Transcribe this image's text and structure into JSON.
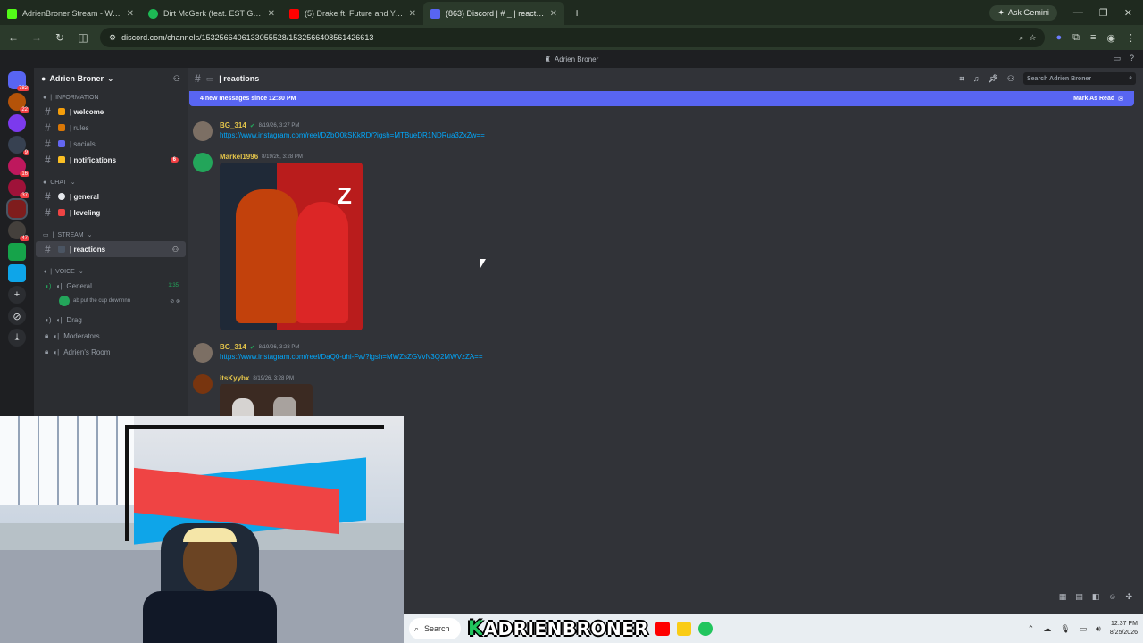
{
  "browser": {
    "tabs": [
      {
        "title": "AdrienBroner Stream - Watch L",
        "favicon_color": "#53fc18",
        "active": false
      },
      {
        "title": "Dirt McGerk (feat. EST Gee & Li",
        "favicon_color": "#1db954",
        "active": false
      },
      {
        "title": "(5) Drake ft. Future and Young",
        "favicon_color": "#ff0000",
        "active": false
      },
      {
        "title": "(863) Discord | # _ | reactions",
        "favicon_color": "#5865f2",
        "active": true
      }
    ],
    "new_tab": "+",
    "ask_gemini": "Ask Gemini",
    "url": "discord.com/channels/1532566406133055528/1532566408561426613"
  },
  "discord": {
    "title_bar": "Adrien Broner",
    "server_badges": [
      "782",
      "22",
      "",
      "9",
      "16",
      "37",
      "",
      "47",
      "",
      ""
    ],
    "guild_name": "Adrien Broner",
    "categories": {
      "information": "INFORMATION",
      "chat": "CHAT",
      "stream": "STREAM",
      "voice": "VOICE"
    },
    "channels": {
      "welcome": "| welcome",
      "rules": "| rules",
      "socials": "| socials",
      "notifications": "| notifications",
      "notifications_mentions": "6",
      "general": "| general",
      "leveling": "| leveling",
      "reactions": "| reactions"
    },
    "voice": {
      "general": "General",
      "general_timer": "1:35",
      "general_user": "ab put the cup downnnn",
      "drag": "Drag",
      "moderators": "Moderators",
      "adriens_room": "Adrien's Room"
    },
    "chat": {
      "channel_name": "| reactions",
      "search_placeholder": "Search Adrien Broner",
      "new_messages": "4 new messages since 12:30 PM",
      "mark_as_read": "Mark As Read",
      "messages": [
        {
          "user": "BG_314",
          "time": "8/19/26, 3:27 PM",
          "text": "https://www.instagram.com/reel/DZbO0kSKkRD/?igsh=MTBueDR1NDRua3ZxZw=="
        },
        {
          "user": "Markel1996",
          "time": "8/19/26, 3:28 PM",
          "text": ""
        },
        {
          "user": "BG_314",
          "time": "8/19/26, 3:28 PM",
          "text": "https://www.instagram.com/reel/DaQ0-uhi-Fw/?igsh=MWZsZGVvN3Q2MWVzZA=="
        },
        {
          "user": "itsKyybx",
          "time": "8/19/26, 3:28 PM",
          "text": ""
        }
      ]
    }
  },
  "taskbar": {
    "search": "Search",
    "brand_k": "K",
    "brand_rest": "ADRIENBRONER",
    "time": "12:37 PM",
    "date": "8/25/2026"
  }
}
